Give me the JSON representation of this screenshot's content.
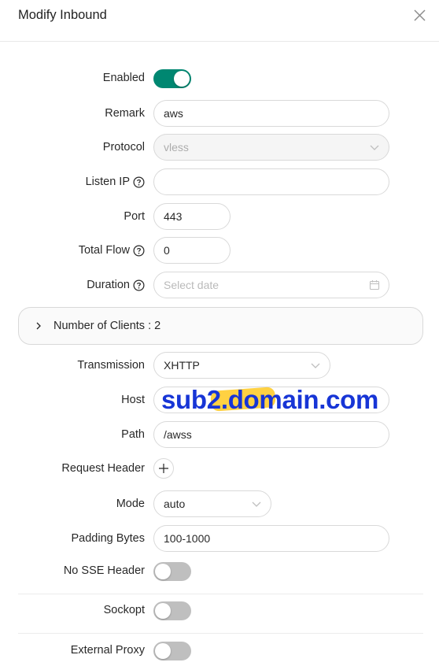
{
  "dialog": {
    "title": "Modify Inbound",
    "close_icon": "close-icon"
  },
  "form": {
    "enabled": {
      "label": "Enabled",
      "value": true
    },
    "remark": {
      "label": "Remark",
      "value": "aws"
    },
    "protocol": {
      "label": "Protocol",
      "value": "vless",
      "disabled": true
    },
    "listen_ip": {
      "label": "Listen IP",
      "value": ""
    },
    "port": {
      "label": "Port",
      "value": "443"
    },
    "total_flow": {
      "label": "Total Flow",
      "value": "0"
    },
    "duration": {
      "label": "Duration",
      "placeholder": "Select date"
    },
    "clients": {
      "label": "Number of Clients : 2"
    },
    "transmission": {
      "label": "Transmission",
      "value": "XHTTP"
    },
    "host": {
      "label": "Host",
      "value": "sub2.domain.com"
    },
    "path": {
      "label": "Path",
      "value": "/awss"
    },
    "request_header": {
      "label": "Request Header"
    },
    "mode": {
      "label": "Mode",
      "value": "auto"
    },
    "padding_bytes": {
      "label": "Padding Bytes",
      "value": "100-1000"
    },
    "no_sse_header": {
      "label": "No SSE Header",
      "value": false
    },
    "sockopt": {
      "label": "Sockopt",
      "value": false
    },
    "external_proxy": {
      "label": "External Proxy",
      "value": false
    }
  },
  "colors": {
    "accent": "#008771",
    "switch_off": "#bfbfbf",
    "border": "#d9d9d9",
    "host_text": "#1735d6",
    "host_highlight": "#ffcc2e"
  }
}
